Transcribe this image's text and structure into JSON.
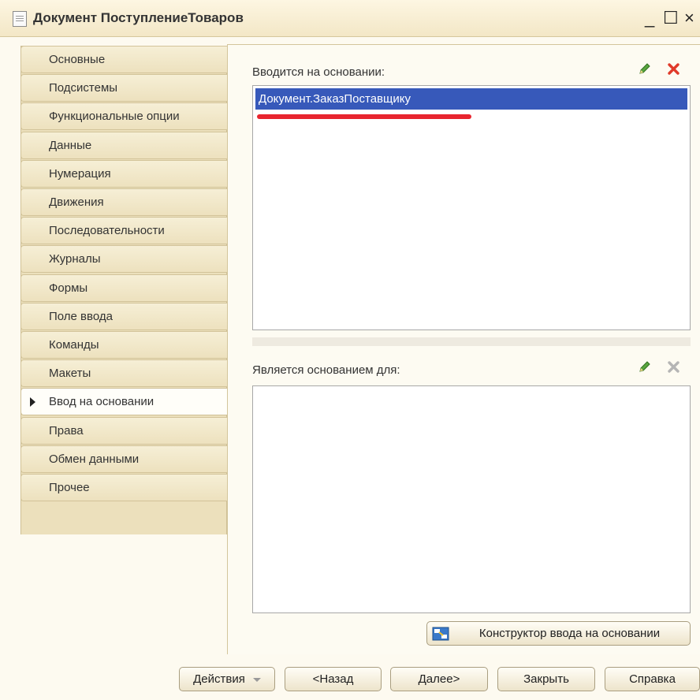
{
  "window": {
    "title": "Документ ПоступлениеТоваров",
    "minimize": "_",
    "maximize": "☐",
    "close": "×",
    "icon": "document-icon"
  },
  "sidebar": {
    "items": [
      {
        "label": "Основные"
      },
      {
        "label": "Подсистемы"
      },
      {
        "label": "Функциональные опции"
      },
      {
        "label": "Данные"
      },
      {
        "label": "Нумерация"
      },
      {
        "label": "Движения"
      },
      {
        "label": "Последовательности"
      },
      {
        "label": "Журналы"
      },
      {
        "label": "Формы"
      },
      {
        "label": "Поле ввода"
      },
      {
        "label": "Команды"
      },
      {
        "label": "Макеты"
      },
      {
        "label": "Ввод на основании",
        "active": true
      },
      {
        "label": "Права"
      },
      {
        "label": "Обмен данными"
      },
      {
        "label": "Прочее"
      }
    ]
  },
  "main": {
    "based_on": {
      "label": "Вводится на основании:",
      "items": [
        "Документ.ЗаказПоставщику"
      ],
      "edit_icon": "pencil-icon",
      "delete_icon": "delete-x-icon",
      "delete_color": "#e03a2a"
    },
    "basis_for": {
      "label": "Является основанием для:",
      "items": [],
      "edit_icon": "pencil-icon",
      "delete_icon": "delete-x-icon",
      "delete_color": "#b5b5b5"
    },
    "constructor_button": "Конструктор ввода на основании"
  },
  "footer": {
    "actions": "Действия",
    "back": "<Назад",
    "next": "Далее>",
    "close": "Закрыть",
    "help": "Справка"
  },
  "colors": {
    "selection": "#3759ba",
    "annotation_underline": "#e8252f",
    "tab_background": "#ece0bc",
    "window_background": "#fdfaf0"
  }
}
